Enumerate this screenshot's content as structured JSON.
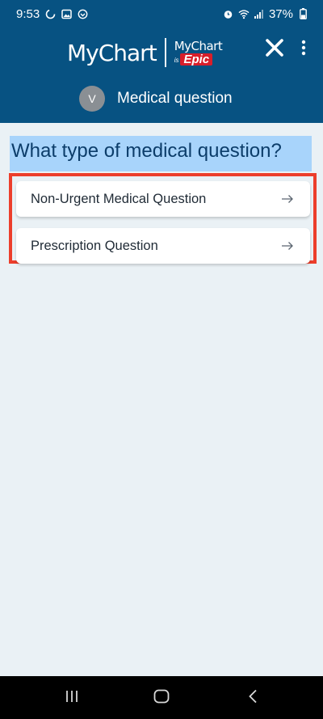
{
  "status_bar": {
    "time": "9:53",
    "battery": "37%",
    "left_icons": [
      "sync-icon",
      "image-icon",
      "notification-icon"
    ],
    "right_icons": [
      "alarm-icon",
      "wifi-icon",
      "signal-icon",
      "battery-icon"
    ]
  },
  "header": {
    "brand_name": "MyChart",
    "brand_sub_name": "MyChart",
    "brand_is": "is",
    "brand_epic": "Epic",
    "avatar_initial": "V",
    "subtitle": "Medical question",
    "close_icon": "close-icon",
    "more_icon": "more-vertical-icon"
  },
  "main": {
    "heading": "What type of medical question?",
    "options": [
      {
        "label": "Non-Urgent Medical Question",
        "icon": "arrow-right-icon"
      },
      {
        "label": "Prescription Question",
        "icon": "arrow-right-icon"
      }
    ]
  },
  "nav_bar": {
    "buttons": [
      "recent-apps-icon",
      "home-icon",
      "back-icon"
    ]
  },
  "colors": {
    "header_bg": "#075282",
    "page_bg": "#eaf1f5",
    "highlight": "#a8d4fb",
    "annotation_border": "#ec3e2b",
    "epic_red": "#d81e2a"
  }
}
